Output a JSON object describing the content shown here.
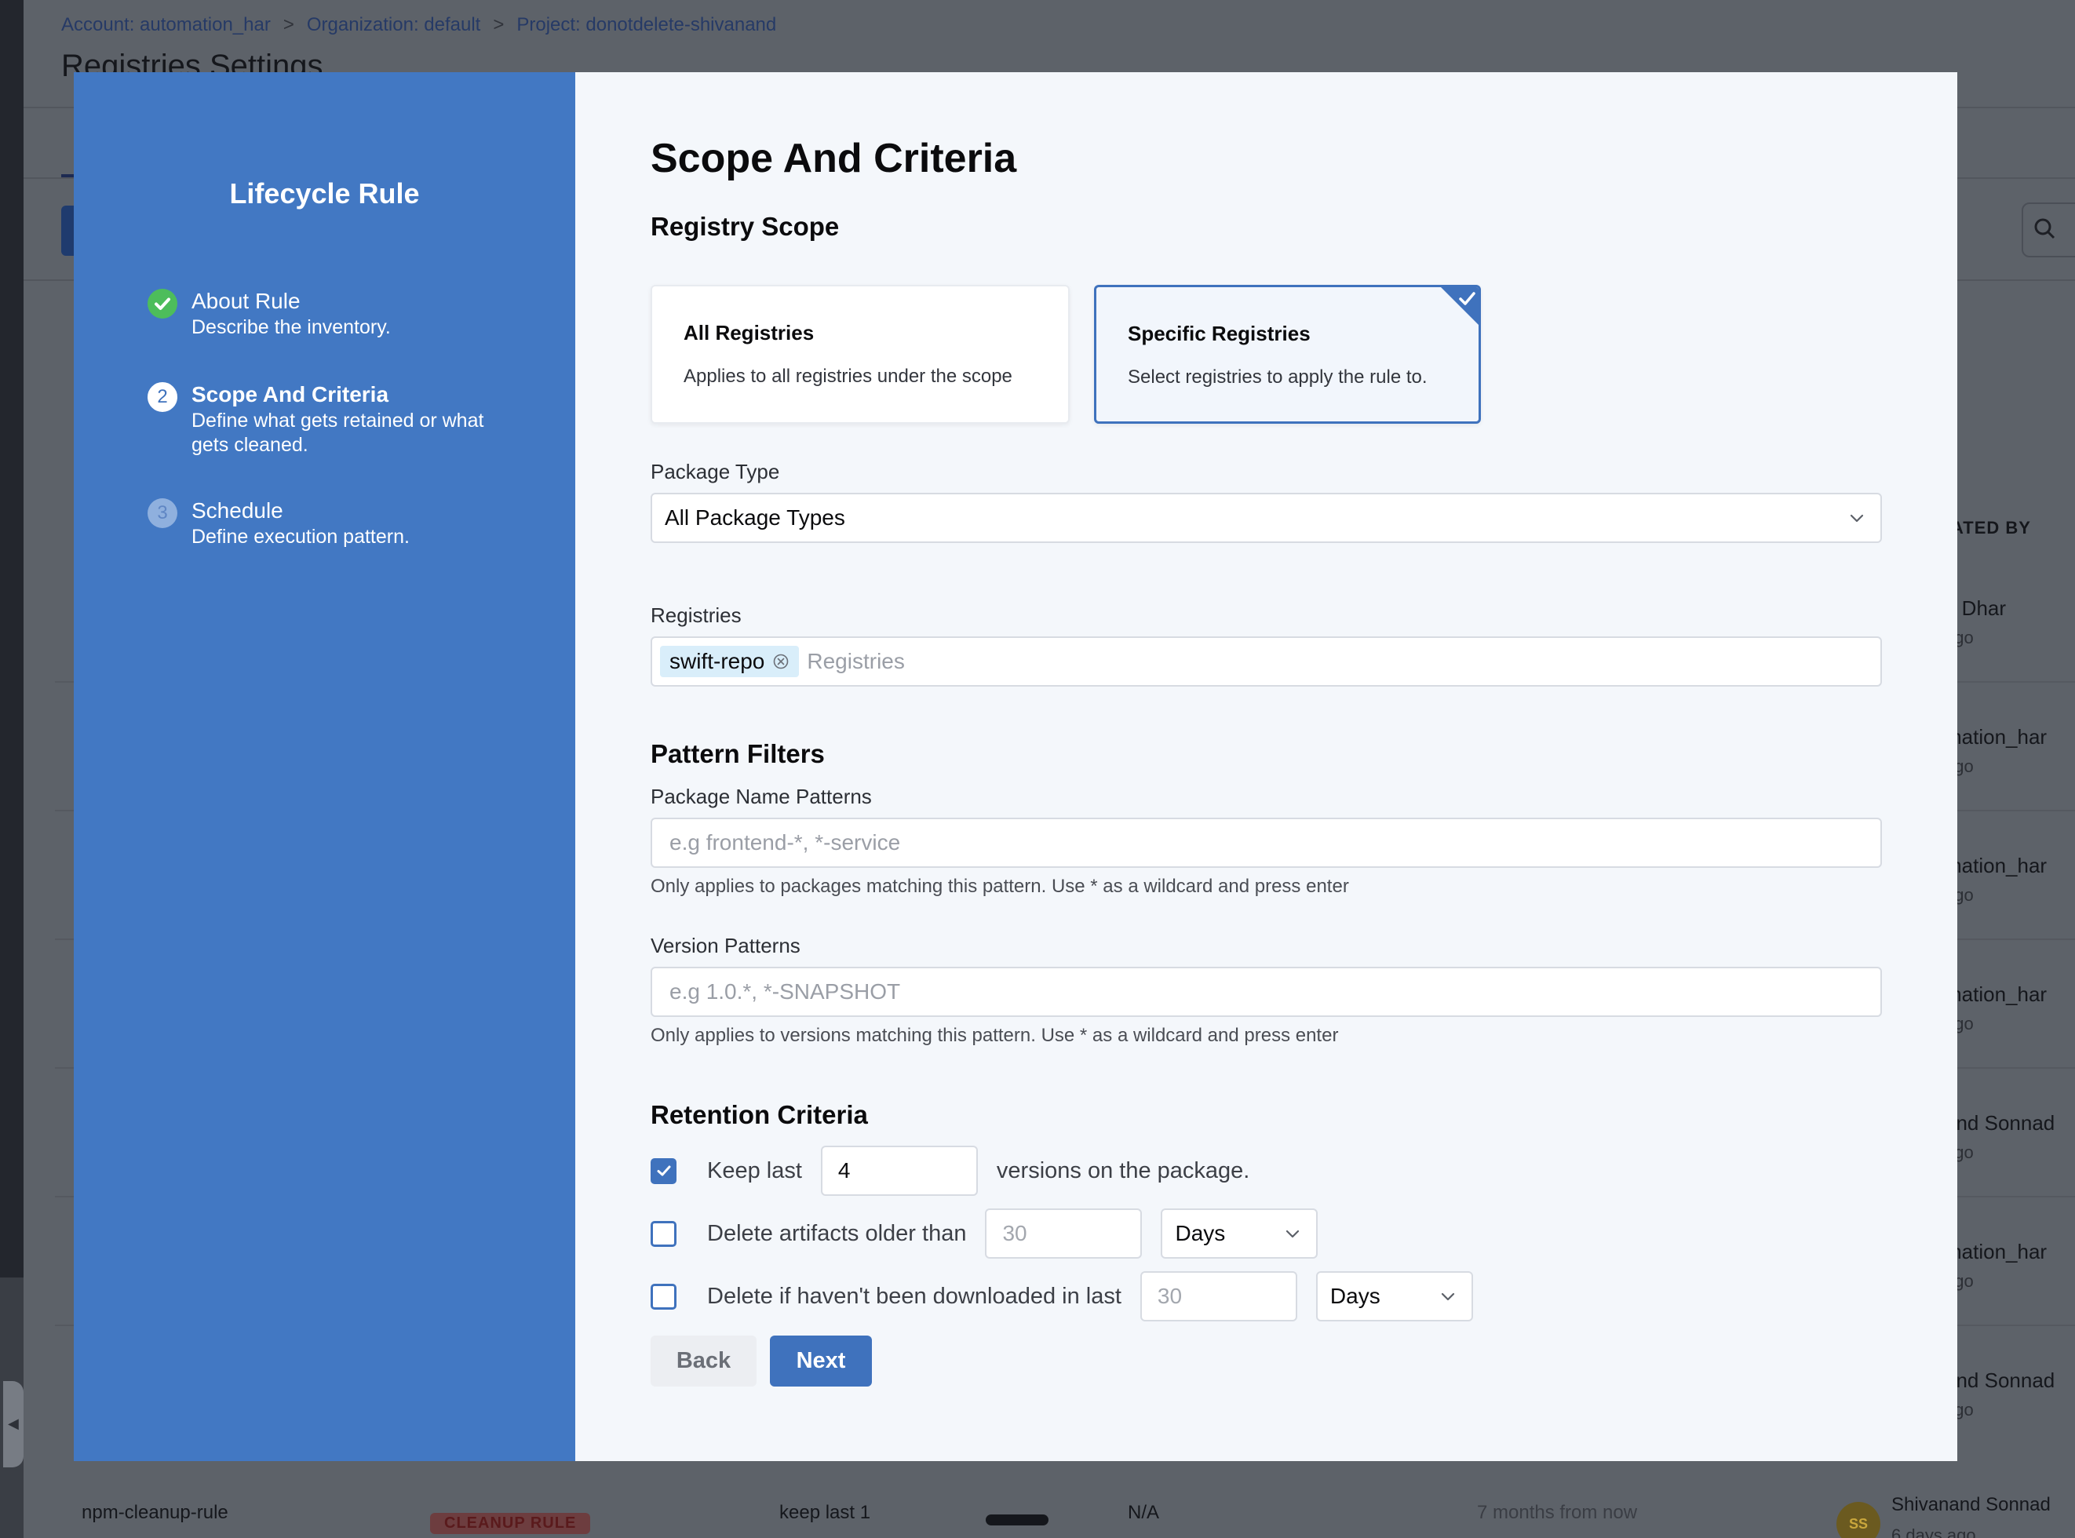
{
  "background": {
    "breadcrumbs": [
      "Account: automation_har",
      "Organization: default",
      "Project: donotdelete-shivanand"
    ],
    "breadcrumb_separator": ">",
    "page_title": "Registries Settings",
    "column_header": "ATED BY",
    "rows": [
      {
        "name": "n Dhar",
        "time": "ago"
      },
      {
        "name": "mation_har",
        "time": "ago"
      },
      {
        "name": "mation_har",
        "time": "ago"
      },
      {
        "name": "mation_har",
        "time": "ago"
      },
      {
        "name": "and Sonnad",
        "time": "ago"
      },
      {
        "name": "mation_har",
        "time": "ago"
      },
      {
        "name": "and Sonnad",
        "time": "ago"
      }
    ],
    "bottom_row": {
      "rule_name": "npm-cleanup-rule",
      "rule_type": "CLEANUP RULE",
      "criteria": "keep last 1",
      "schedule": "N/A",
      "next_run": "7 months from now",
      "avatar_initials": "SS",
      "created_by": "Shivanand Sonnad",
      "created_time": "6 days ago"
    }
  },
  "sidebar": {
    "title": "Lifecycle Rule",
    "steps": [
      {
        "number": "1",
        "title": "About Rule",
        "description": "Describe the inventory.",
        "state": "done"
      },
      {
        "number": "2",
        "title": "Scope And Criteria",
        "description": "Define what gets retained or what gets cleaned.",
        "state": "active"
      },
      {
        "number": "3",
        "title": "Schedule",
        "description": "Define execution pattern.",
        "state": "future"
      }
    ]
  },
  "main": {
    "title": "Scope And Criteria",
    "registry_scope": {
      "heading": "Registry Scope",
      "options": [
        {
          "title": "All Registries",
          "description": "Applies to all registries under the scope",
          "selected": false
        },
        {
          "title": "Specific Registries",
          "description": "Select registries to apply the rule to.",
          "selected": true
        }
      ]
    },
    "package_type": {
      "label": "Package Type",
      "value": "All Package Types"
    },
    "registries": {
      "label": "Registries",
      "selected_chip": "swift-repo",
      "placeholder": "Registries"
    },
    "pattern_filters": {
      "heading": "Pattern Filters",
      "package_name": {
        "label": "Package Name Patterns",
        "placeholder": "e.g frontend-*, *-service",
        "help": "Only applies to packages matching this pattern. Use * as a wildcard and press enter"
      },
      "version": {
        "label": "Version Patterns",
        "placeholder": "e.g 1.0.*, *-SNAPSHOT",
        "help": "Only applies to versions matching this pattern. Use * as a wildcard and press enter"
      }
    },
    "retention": {
      "heading": "Retention Criteria",
      "keep_last": {
        "checked": true,
        "prefix": "Keep last",
        "value": "4",
        "suffix": "versions on the package."
      },
      "older_than": {
        "checked": false,
        "prefix": "Delete artifacts older than",
        "placeholder": "30",
        "unit": "Days"
      },
      "not_downloaded": {
        "checked": false,
        "prefix": "Delete if haven't been downloaded in last",
        "placeholder": "30",
        "unit": "Days"
      }
    },
    "buttons": {
      "back": "Back",
      "next": "Next"
    }
  },
  "colors": {
    "sidebar_blue": "#4278c3",
    "primary": "#3f72bd",
    "success": "#4dbd5b",
    "chip_bg": "#d9eefa"
  }
}
